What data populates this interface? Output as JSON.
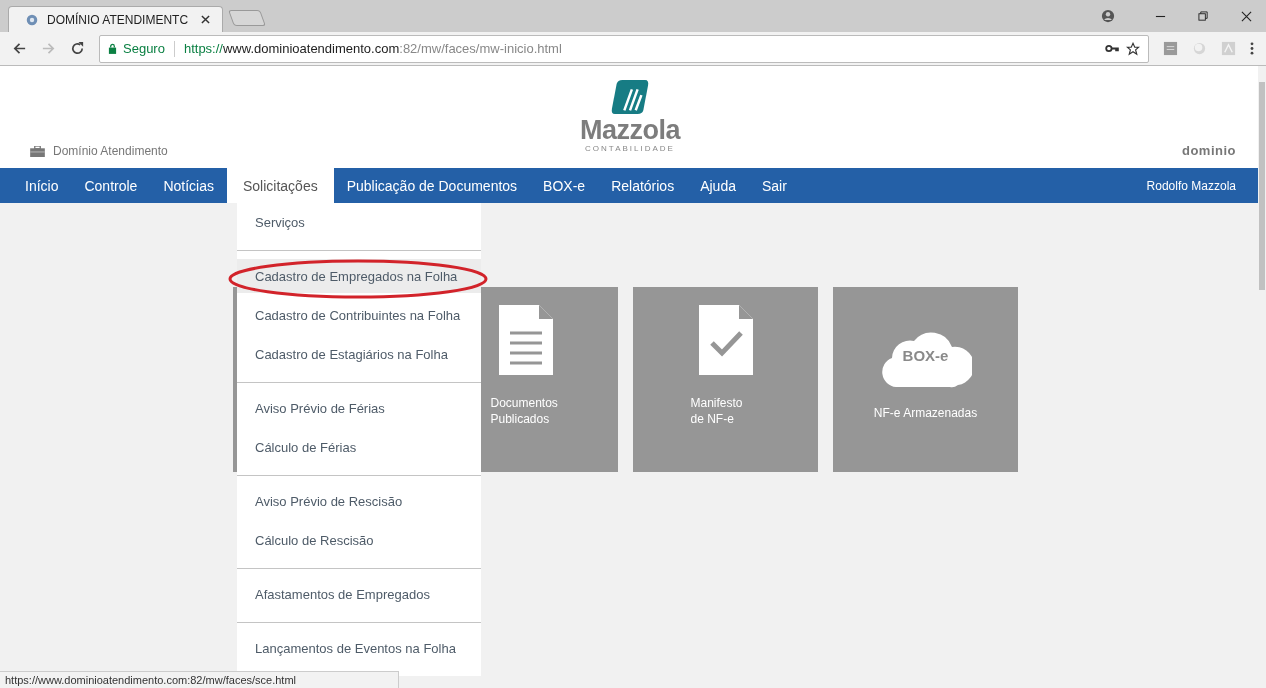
{
  "browser": {
    "tab": {
      "title": "DOMÍNIO ATENDIMENTC"
    },
    "address": {
      "security": "Seguro",
      "scheme": "https://",
      "host": "www.dominioatendimento.com",
      "path": ":82/mw/faces/mw-inicio.html"
    }
  },
  "header": {
    "site_name": "Domínio Atendimento",
    "logo": {
      "name": "Mazzola",
      "tagline": "CONTABILIDADE"
    },
    "brand": "dominio"
  },
  "nav": {
    "items": [
      {
        "label": "Início",
        "selected": false
      },
      {
        "label": "Controle",
        "selected": false
      },
      {
        "label": "Notícias",
        "selected": false
      },
      {
        "label": "Solicitações",
        "selected": true
      },
      {
        "label": "Publicação de Documentos",
        "selected": false
      },
      {
        "label": "BOX-e",
        "selected": false
      },
      {
        "label": "Relatórios",
        "selected": false
      },
      {
        "label": "Ajuda",
        "selected": false
      },
      {
        "label": "Sair",
        "selected": false
      }
    ],
    "user": "Rodolfo Mazzola"
  },
  "dropdown": {
    "groups": [
      [
        {
          "label": "Serviços",
          "highlighted": false,
          "circled": false
        }
      ],
      [
        {
          "label": "Cadastro de Empregados na Folha",
          "highlighted": true,
          "circled": true
        },
        {
          "label": "Cadastro de Contribuintes na Folha",
          "highlighted": false,
          "circled": false
        },
        {
          "label": "Cadastro de Estagiários na Folha",
          "highlighted": false,
          "circled": false
        }
      ],
      [
        {
          "label": "Aviso Prévio de Férias",
          "highlighted": false,
          "circled": false
        },
        {
          "label": "Cálculo de Férias",
          "highlighted": false,
          "circled": false
        }
      ],
      [
        {
          "label": "Aviso Prévio de Rescisão",
          "highlighted": false,
          "circled": false
        },
        {
          "label": "Cálculo de Rescisão",
          "highlighted": false,
          "circled": false
        }
      ],
      [
        {
          "label": "Afastamentos de Empregados",
          "highlighted": false,
          "circled": false
        }
      ],
      [
        {
          "label": "Lançamentos de Eventos na Folha",
          "highlighted": false,
          "circled": false
        }
      ]
    ]
  },
  "tiles": [
    {
      "kind": "blank"
    },
    {
      "kind": "document",
      "label": "Documentos\nPublicados"
    },
    {
      "kind": "check",
      "label": "Manifesto\nde NF-e"
    },
    {
      "kind": "cloud",
      "badge": "BOX-e",
      "label": "NF-e Armazenadas"
    }
  ],
  "status_url": "https://www.dominioatendimento.com:82/mw/faces/sce.html"
}
